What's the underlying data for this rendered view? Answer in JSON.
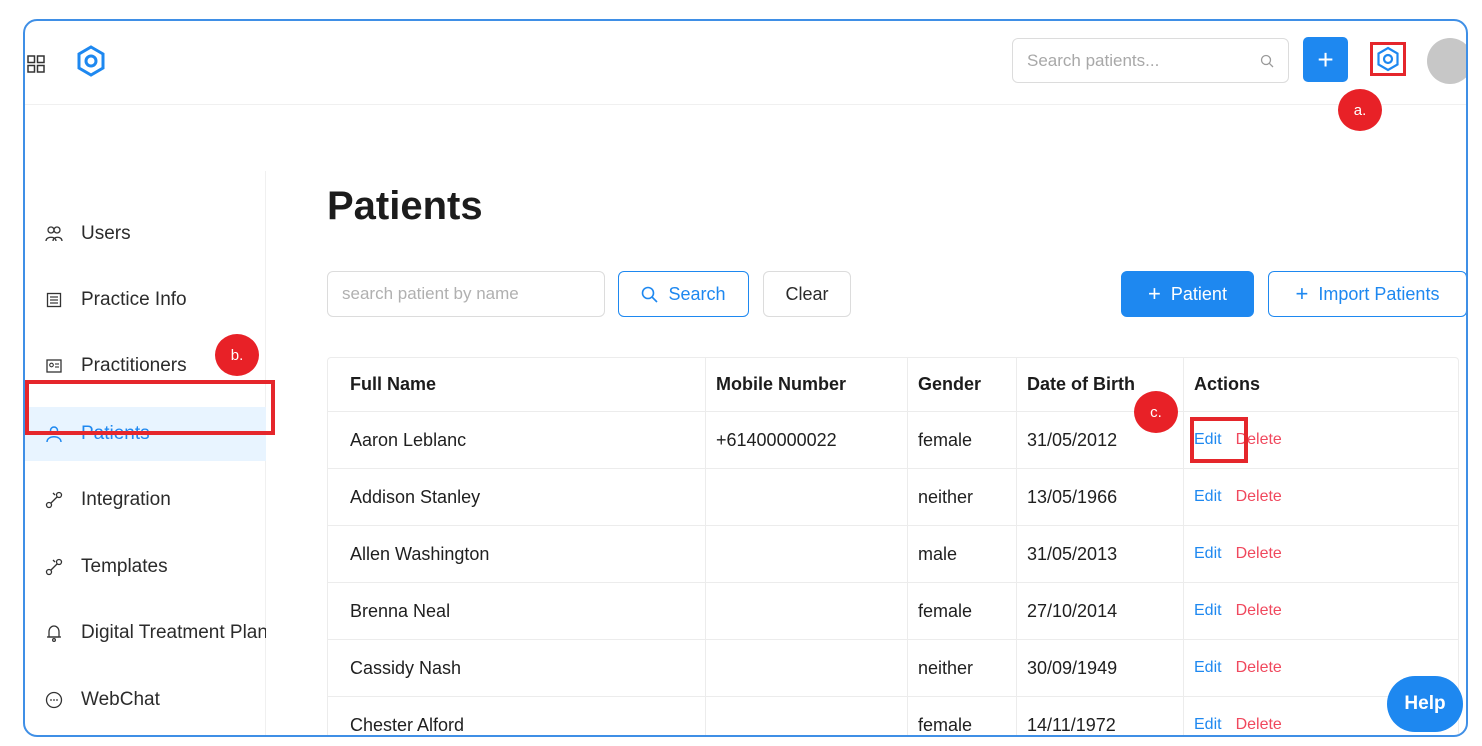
{
  "header": {
    "search_placeholder": "Search patients...",
    "add_label": "+"
  },
  "badges": {
    "a": "a.",
    "b": "b.",
    "c": "c."
  },
  "sidebar": {
    "items": [
      {
        "label": "Users",
        "icon": "users-icon"
      },
      {
        "label": "Practice Info",
        "icon": "document-icon"
      },
      {
        "label": "Practitioners",
        "icon": "id-card-icon"
      },
      {
        "label": "Patients",
        "icon": "user-icon"
      },
      {
        "label": "Integration",
        "icon": "link-icon"
      },
      {
        "label": "Templates",
        "icon": "link-icon"
      },
      {
        "label": "Digital Treatment Plan",
        "icon": "bell-icon"
      },
      {
        "label": "WebChat",
        "icon": "chat-icon"
      }
    ]
  },
  "main": {
    "title": "Patients",
    "name_search_placeholder": "search patient by name",
    "search_label": "Search",
    "clear_label": "Clear",
    "add_patient_label": "Patient",
    "import_label": "Import Patients"
  },
  "table": {
    "headers": [
      "Full Name",
      "Mobile Number",
      "Gender",
      "Date of Birth",
      "Actions"
    ],
    "rows": [
      {
        "name": "Aaron Leblanc",
        "mobile": "+61400000022",
        "gender": "female",
        "dob": "31/05/2012",
        "edit": "Edit",
        "delete": "Delete"
      },
      {
        "name": "Addison Stanley",
        "mobile": "",
        "gender": "neither",
        "dob": "13/05/1966",
        "edit": "Edit",
        "delete": "Delete"
      },
      {
        "name": "Allen Washington",
        "mobile": "",
        "gender": "male",
        "dob": "31/05/2013",
        "edit": "Edit",
        "delete": "Delete"
      },
      {
        "name": "Brenna Neal",
        "mobile": "",
        "gender": "female",
        "dob": "27/10/2014",
        "edit": "Edit",
        "delete": "Delete"
      },
      {
        "name": "Cassidy Nash",
        "mobile": "",
        "gender": "neither",
        "dob": "30/09/1949",
        "edit": "Edit",
        "delete": "Delete"
      },
      {
        "name": "Chester Alford",
        "mobile": "",
        "gender": "female",
        "dob": "14/11/1972",
        "edit": "Edit",
        "delete": "Delete"
      }
    ]
  },
  "help_label": "Help",
  "colors": {
    "accent": "#1e88f0",
    "annotation": "#e5262b",
    "danger": "#f0485d"
  }
}
